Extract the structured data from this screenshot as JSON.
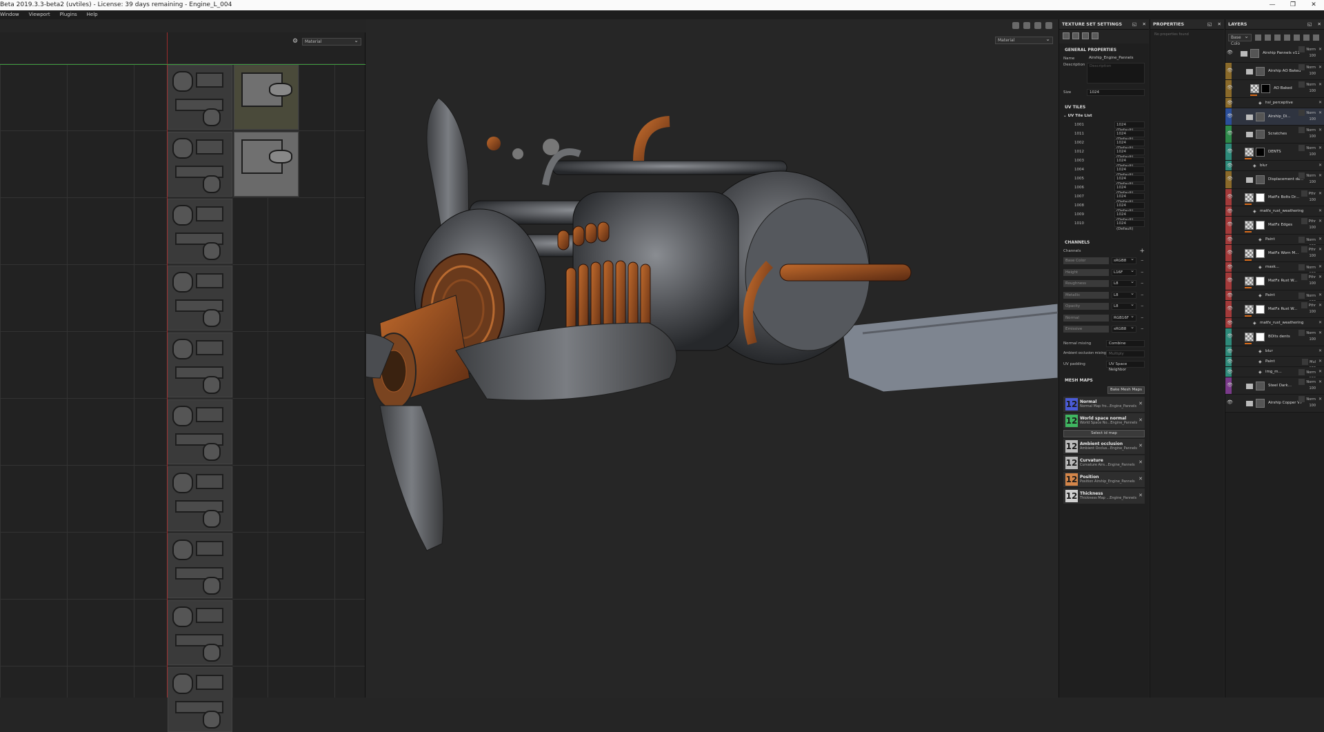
{
  "window": {
    "title": "Beta 2019.3.3-beta2 (uvtiles) - License: 39 days remaining - Engine_L_004",
    "controls": [
      "—",
      "❐",
      "✕"
    ]
  },
  "menu": [
    "Window",
    "Viewport",
    "Plugins",
    "Help"
  ],
  "view2d": {
    "gear": "⚙",
    "mode": "Material"
  },
  "view3d": {
    "mode": "Material"
  },
  "texture_set": {
    "title": "TEXTURE SET SETTINGS",
    "general": "GENERAL PROPERTIES",
    "name_label": "Name",
    "name": "Airship_Engine_Pannels",
    "desc_label": "Description",
    "desc_placeholder": "Description",
    "size_label": "Size",
    "size": "1024",
    "uv_tiles": "UV TILES",
    "uv_tile_list": "UV Tile List",
    "tiles": [
      {
        "id": "1001",
        "res": "1024 (Default)"
      },
      {
        "id": "1011",
        "res": "1024 (Default)"
      },
      {
        "id": "1002",
        "res": "1024 (Default)"
      },
      {
        "id": "1012",
        "res": "1024 (Default)"
      },
      {
        "id": "1003",
        "res": "1024 (Default)"
      },
      {
        "id": "1004",
        "res": "1024 (Default)"
      },
      {
        "id": "1005",
        "res": "1024 (Default)"
      },
      {
        "id": "1006",
        "res": "1024 (Default)"
      },
      {
        "id": "1007",
        "res": "1024 (Default)"
      },
      {
        "id": "1008",
        "res": "1024 (Default)"
      },
      {
        "id": "1009",
        "res": "1024 (Default)"
      },
      {
        "id": "1010",
        "res": "1024 (Default)"
      }
    ],
    "channels_title": "CHANNELS",
    "channels_label": "Channels",
    "channels": [
      {
        "name": "Base Color",
        "format": "sRGB8"
      },
      {
        "name": "Height",
        "format": "L16F"
      },
      {
        "name": "Roughness",
        "format": "L8"
      },
      {
        "name": "Metallic",
        "format": "L8"
      },
      {
        "name": "Opacity",
        "format": "L8"
      },
      {
        "name": "Normal",
        "format": "RGB16F"
      },
      {
        "name": "Emissive",
        "format": "sRGB8"
      }
    ],
    "normal_mixing_label": "Normal mixing",
    "normal_mixing": "Combine",
    "ao_mixing_label": "Ambient occlusion mixing",
    "ao_mixing": "Multiply",
    "uv_padding_label": "UV padding",
    "uv_padding": "UV Space Neighbor",
    "mesh_maps_title": "MESH MAPS",
    "bake_button": "Bake Mesh Maps",
    "select_map": "Select id map",
    "mesh_maps": [
      {
        "title": "Normal",
        "sub": "Normal Map fro...Engine_Pannels",
        "color": "#4a5bd6"
      },
      {
        "title": "World space normal",
        "sub": "World Space No...Engine_Pannels",
        "color": "#3fb560"
      },
      {
        "title": "Ambient occlusion",
        "sub": "Ambient Occlus...Engine_Pannels",
        "color": "#bdbdbd"
      },
      {
        "title": "Curvature",
        "sub": "Curvature Airs...Engine_Pannels",
        "color": "#b8b8b8"
      },
      {
        "title": "Position",
        "sub": "Position Airship_Engine_Pannels",
        "color": "#d4864a"
      },
      {
        "title": "Thickness",
        "sub": "Thickness Map ...Engine_Pannels",
        "color": "#cfcfcf"
      }
    ]
  },
  "properties": {
    "title": "PROPERTIES",
    "empty": "No properties found"
  },
  "layers": {
    "title": "LAYERS",
    "channel": "Base Colo",
    "items": [
      {
        "name": "Airship Pannels v11",
        "blend": "Norm",
        "op": "100",
        "strip": "#232323",
        "type": "folder",
        "indent": 0
      },
      {
        "name": "Airship AO Baked",
        "blend": "Norm",
        "op": "100",
        "strip": "#8a6a2a",
        "type": "folder",
        "indent": 1
      },
      {
        "name": "AO Baked",
        "blend": "Norm",
        "op": "100",
        "strip": "#8a6a2a",
        "type": "fill",
        "indent": 2
      },
      {
        "name": "hsl_perceptive",
        "blend": "",
        "op": "",
        "strip": "#8a6a2a",
        "type": "sub",
        "indent": 3
      },
      {
        "name": "Airship_Di...",
        "blend": "Norm",
        "op": "100",
        "strip": "#2b4f9a",
        "type": "folder",
        "indent": 1
      },
      {
        "name": "Scratches",
        "blend": "Norm",
        "op": "100",
        "strip": "#2e8a4a",
        "type": "folder",
        "indent": 1
      },
      {
        "name": "DENTS",
        "blend": "Norm",
        "op": "100",
        "strip": "#2e8a7a",
        "type": "fill",
        "indent": 1
      },
      {
        "name": "blur",
        "blend": "",
        "op": "",
        "strip": "#2e8a7a",
        "type": "sub",
        "indent": 2
      },
      {
        "name": "Displacement de...",
        "blend": "Norm",
        "op": "100",
        "strip": "#8a6a2a",
        "type": "folder",
        "indent": 1
      },
      {
        "name": "MatFx Bolts Dr...",
        "blend": "Pthr",
        "op": "100",
        "strip": "#a33a3a",
        "type": "fill",
        "indent": 1
      },
      {
        "name": "matfx_rust_weathering",
        "blend": "",
        "op": "",
        "strip": "#a33a3a",
        "type": "sub",
        "indent": 2
      },
      {
        "name": "MatFx Edges",
        "blend": "Pthr",
        "op": "100",
        "strip": "#a33a3a",
        "type": "fill",
        "indent": 1
      },
      {
        "name": "Paint",
        "blend": "Norm",
        "op": "100",
        "strip": "#a33a3a",
        "type": "sub",
        "indent": 3
      },
      {
        "name": "MatFx Worn M...",
        "blend": "Pthr",
        "op": "100",
        "strip": "#a33a3a",
        "type": "fill",
        "indent": 1
      },
      {
        "name": "mask...",
        "blend": "Norm",
        "op": "100",
        "strip": "#a33a3a",
        "type": "sub",
        "indent": 3
      },
      {
        "name": "MatFx Rust W...",
        "blend": "Pthr",
        "op": "100",
        "strip": "#a33a3a",
        "type": "fill",
        "indent": 1
      },
      {
        "name": "Paint",
        "blend": "Norm",
        "op": "100",
        "strip": "#a33a3a",
        "type": "sub",
        "indent": 3
      },
      {
        "name": "MatFx Rust W...",
        "blend": "Pthr",
        "op": "100",
        "strip": "#a33a3a",
        "type": "fill",
        "indent": 1
      },
      {
        "name": "matfx_rust_weathering",
        "blend": "",
        "op": "",
        "strip": "#a33a3a",
        "type": "sub",
        "indent": 2
      },
      {
        "name": "BOlts dents",
        "blend": "Norm",
        "op": "100",
        "strip": "#2e8a7a",
        "type": "fill",
        "indent": 1
      },
      {
        "name": "blur",
        "blend": "",
        "op": "",
        "strip": "#2e8a7a",
        "type": "sub",
        "indent": 3
      },
      {
        "name": "Paint",
        "blend": "Mul",
        "op": "100",
        "strip": "#2e8a7a",
        "type": "sub",
        "indent": 3
      },
      {
        "name": "img_m...",
        "blend": "Norm",
        "op": "100",
        "strip": "#2e8a7a",
        "type": "sub",
        "indent": 3
      },
      {
        "name": "Steel Dark...",
        "blend": "Norm",
        "op": "100",
        "strip": "#7a3a8a",
        "type": "folder",
        "indent": 1
      },
      {
        "name": "Airship Copper V7",
        "blend": "Norm",
        "op": "100",
        "strip": "#232323",
        "type": "folder",
        "indent": 1
      }
    ]
  }
}
